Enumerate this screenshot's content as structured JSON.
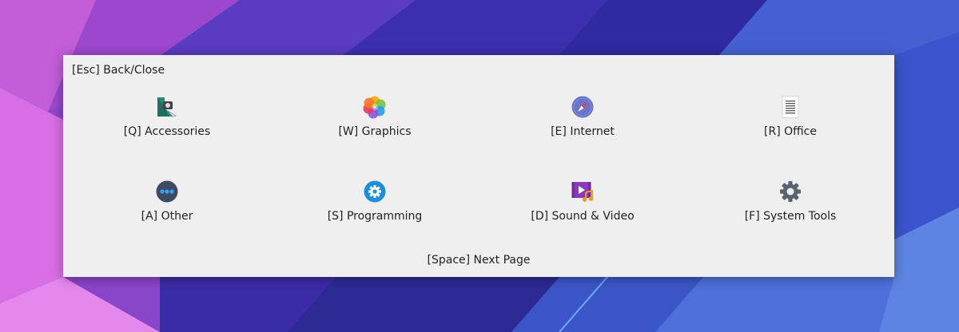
{
  "menu": {
    "esc_hint": "[Esc] Back/Close",
    "next_hint": "[Space] Next Page",
    "items": [
      {
        "label": "[Q] Accessories",
        "icon": "accessories-icon"
      },
      {
        "label": "[W] Graphics",
        "icon": "graphics-icon"
      },
      {
        "label": "[E] Internet",
        "icon": "internet-icon"
      },
      {
        "label": "[R] Office",
        "icon": "office-icon"
      },
      {
        "label": "[A] Other",
        "icon": "other-icon"
      },
      {
        "label": "[S] Programming",
        "icon": "programming-icon"
      },
      {
        "label": "[D] Sound & Video",
        "icon": "sound-video-icon"
      },
      {
        "label": "[F] System Tools",
        "icon": "system-tools-icon"
      }
    ]
  },
  "colors": {
    "panel_background": "#efefef",
    "text": "#222222",
    "wallpaper_purple": "#b04fd0",
    "wallpaper_blue": "#3a2fa8"
  }
}
